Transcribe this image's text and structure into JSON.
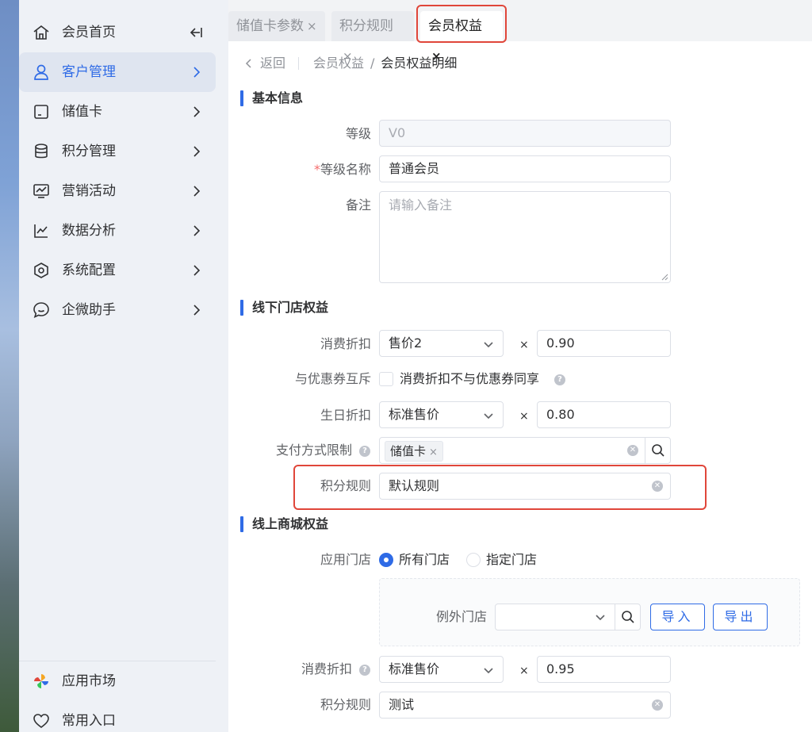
{
  "sidebar": {
    "items": [
      {
        "label": "会员首页",
        "icon": "home-icon"
      },
      {
        "label": "客户管理",
        "icon": "user-icon"
      },
      {
        "label": "储值卡",
        "icon": "card-icon"
      },
      {
        "label": "积分管理",
        "icon": "database-icon"
      },
      {
        "label": "营销活动",
        "icon": "chart-screen-icon"
      },
      {
        "label": "数据分析",
        "icon": "line-chart-icon"
      },
      {
        "label": "系统配置",
        "icon": "settings-hex-icon"
      },
      {
        "label": "企微助手",
        "icon": "chat-icon"
      }
    ],
    "bottom": [
      {
        "label": "应用市场",
        "icon": "app-market-icon"
      },
      {
        "label": "常用入口",
        "icon": "heart-icon"
      }
    ]
  },
  "tabs": [
    {
      "label": "储值卡参数",
      "close": "×"
    },
    {
      "label": "积分规则",
      "close": "×"
    },
    {
      "label": "会员权益",
      "close": "×"
    }
  ],
  "breadcrumb": {
    "back": "返回",
    "parent": "会员权益",
    "sep": "/",
    "current": "会员权益明细"
  },
  "basic": {
    "title": "基本信息",
    "level_label": "等级",
    "level_value": "V0",
    "name_required": "*",
    "name_label": "等级名称",
    "name_value": "普通会员",
    "remark_label": "备注",
    "remark_placeholder": "请输入备注"
  },
  "offline": {
    "title": "线下门店权益",
    "discount_label": "消费折扣",
    "discount_select": "售价2",
    "discount_times": "×",
    "discount_value": "0.90",
    "coupon_label": "与优惠券互斥",
    "coupon_text": "消费折扣不与优惠券同享",
    "birthday_label": "生日折扣",
    "birthday_select": "标准售价",
    "birthday_times": "×",
    "birthday_value": "0.80",
    "pay_label": "支付方式限制",
    "pay_tag": "储值卡",
    "pay_tag_close": "×",
    "points_label": "积分规则",
    "points_value": "默认规则"
  },
  "online": {
    "title": "线上商城权益",
    "store_label": "应用门店",
    "store_opt1": "所有门店",
    "store_opt2": "指定门店",
    "except_label": "例外门店",
    "import_btn": "导入",
    "export_btn": "导出",
    "discount_label": "消费折扣",
    "discount_select": "标准售价",
    "discount_times": "×",
    "discount_value": "0.95",
    "points_label": "积分规则",
    "points_value": "测试"
  },
  "colors": {
    "accent": "#2f6be6",
    "highlight": "#e0463a",
    "required": "#f56c6c"
  }
}
